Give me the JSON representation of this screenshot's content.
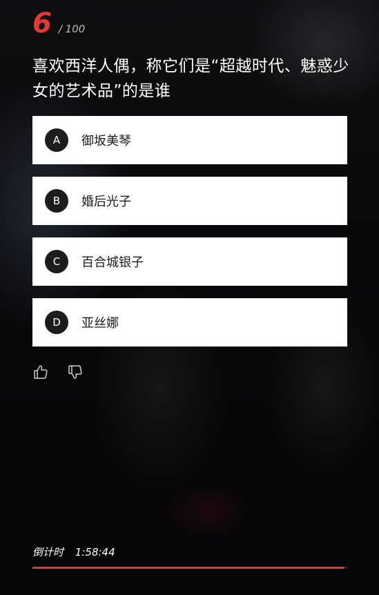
{
  "question": {
    "current": "6",
    "total": "/ 100",
    "text": "喜欢西洋人偶，称它们是“超越时代、魅惑少女的艺术品”的是谁"
  },
  "options": [
    {
      "letter": "A",
      "text": "御坂美琴"
    },
    {
      "letter": "B",
      "text": "婚后光子"
    },
    {
      "letter": "C",
      "text": "百合城银子"
    },
    {
      "letter": "D",
      "text": "亚丝娜"
    }
  ],
  "feedback": {
    "like_icon": "thumbs-up-icon",
    "dislike_icon": "thumbs-down-icon"
  },
  "timer": {
    "label": "倒计时",
    "value": "1:58:44",
    "progress": 0.99
  },
  "colors": {
    "accent": "#e53935",
    "option_bg": "#ffffff",
    "letter_bg": "#1c1c1c"
  }
}
